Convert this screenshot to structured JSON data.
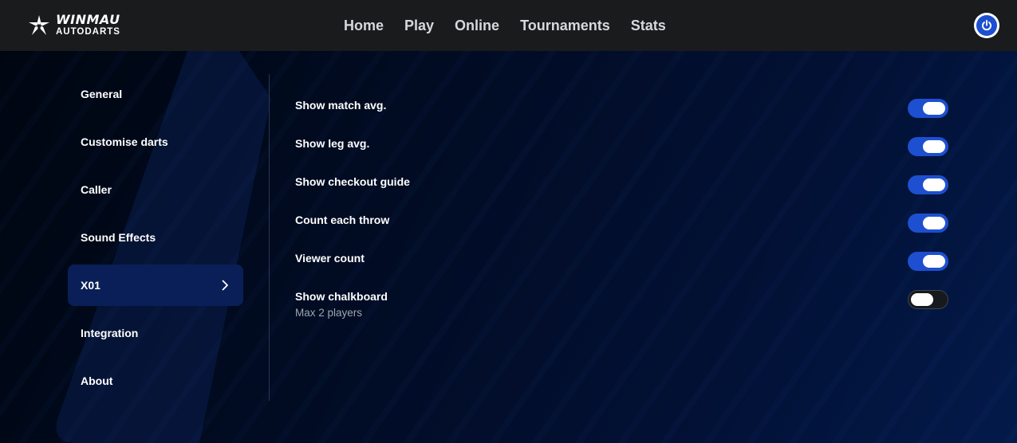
{
  "brand": {
    "name": "WINMAU",
    "subtitle": "AUTODARTS",
    "logo_icon": "winmau-star-icon"
  },
  "nav": {
    "items": [
      "Home",
      "Play",
      "Online",
      "Tournaments",
      "Stats"
    ]
  },
  "account": {
    "icon": "power-icon",
    "accent": "#1d4fd0"
  },
  "sidebar": {
    "items": [
      {
        "label": "General",
        "active": false
      },
      {
        "label": "Customise darts",
        "active": false
      },
      {
        "label": "Caller",
        "active": false
      },
      {
        "label": "Sound Effects",
        "active": false
      },
      {
        "label": "X01",
        "active": true
      },
      {
        "label": "Integration",
        "active": false
      },
      {
        "label": "About",
        "active": false
      }
    ],
    "active_icon": "chevron-right-icon"
  },
  "settings": [
    {
      "label": "Show match avg.",
      "sublabel": "",
      "enabled": true
    },
    {
      "label": "Show leg avg.",
      "sublabel": "",
      "enabled": true
    },
    {
      "label": "Show checkout guide",
      "sublabel": "",
      "enabled": true
    },
    {
      "label": "Count each throw",
      "sublabel": "",
      "enabled": true
    },
    {
      "label": "Viewer count",
      "sublabel": "",
      "enabled": true
    },
    {
      "label": "Show chalkboard",
      "sublabel": "Max 2 players",
      "enabled": false
    }
  ],
  "colors": {
    "toggle_on": "#1d4fd0",
    "toggle_off": "#17191d",
    "active_item": "#0a1f57"
  }
}
